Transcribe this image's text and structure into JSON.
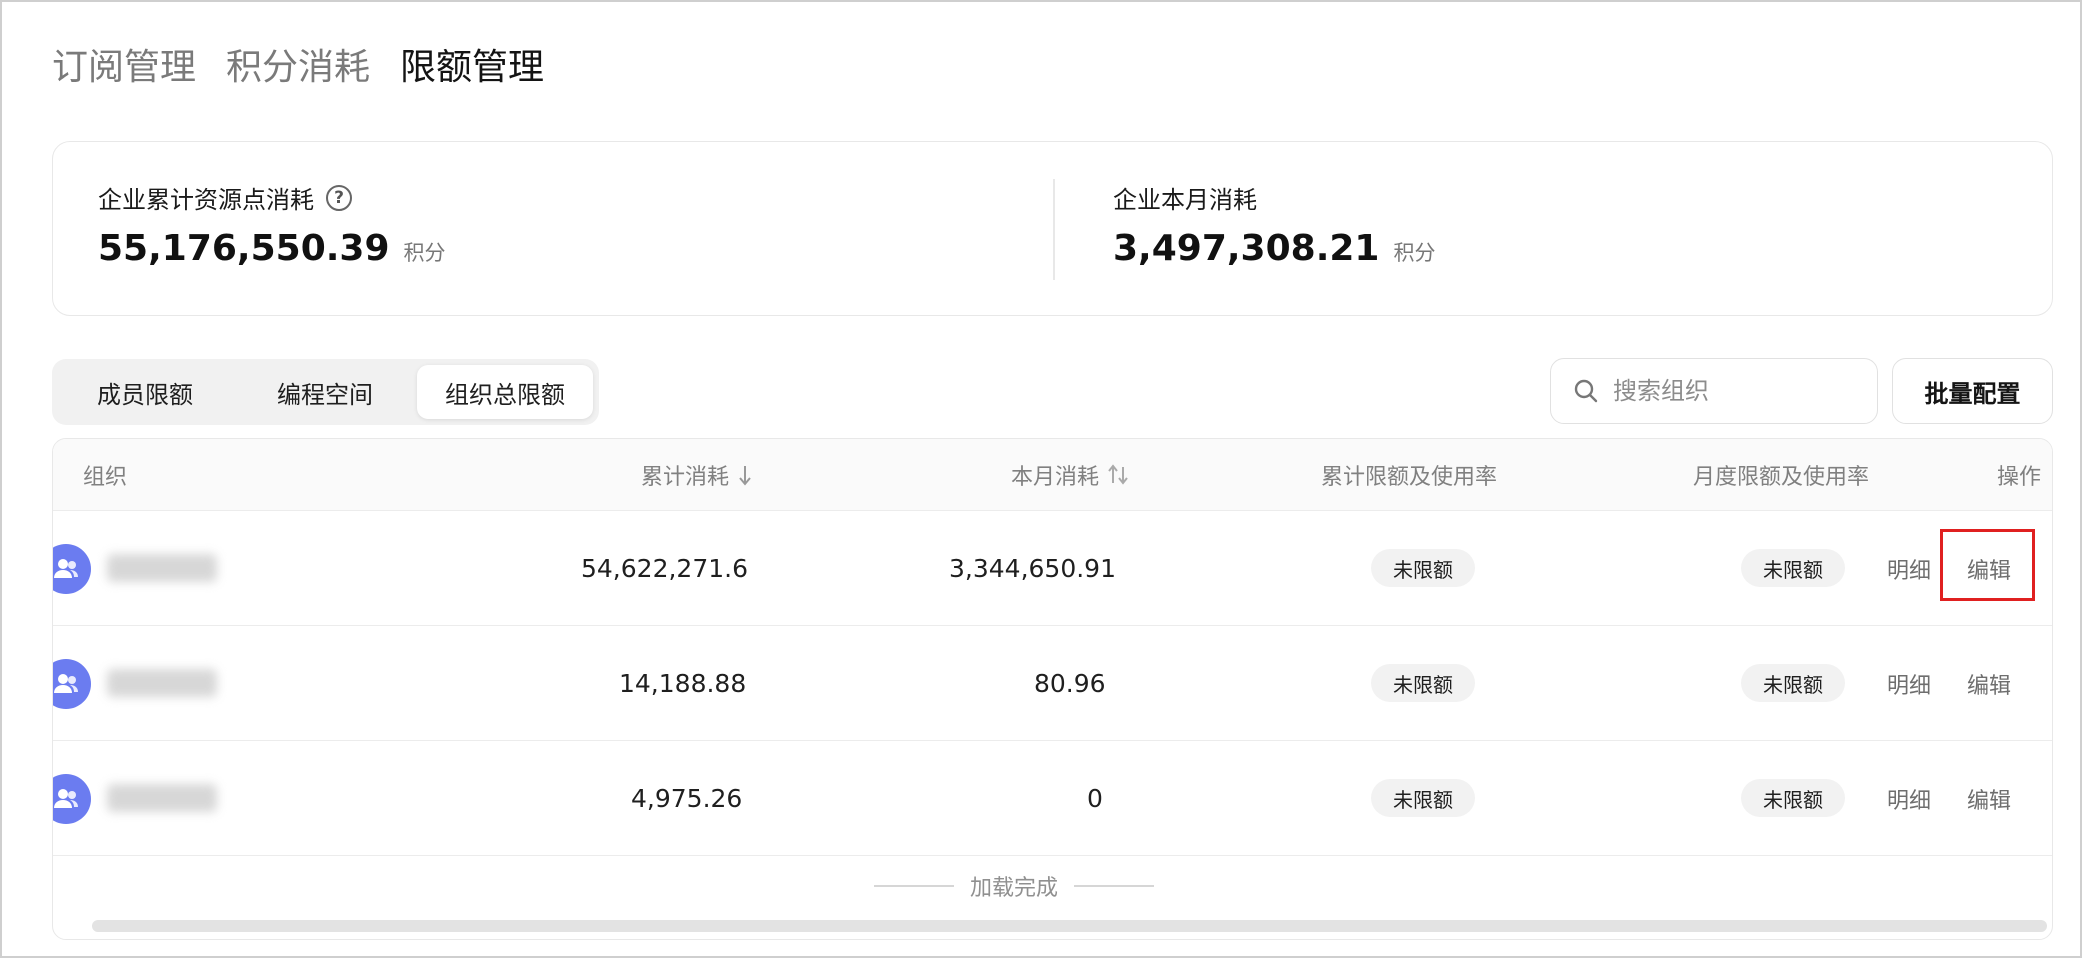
{
  "top_tabs": [
    "订阅管理",
    "积分消耗",
    "限额管理"
  ],
  "summary": {
    "total_label": "企业累计资源点消耗",
    "total_value": "55,176,550.39",
    "month_label": "企业本月消耗",
    "month_value": "3,497,308.21",
    "unit": "积分"
  },
  "segments": [
    "成员限额",
    "编程空间",
    "组织总限额"
  ],
  "active_segment": "组织总限额",
  "search": {
    "placeholder": "搜索组织"
  },
  "batch_button": "批量配置",
  "columns": [
    "组织",
    "累计消耗",
    "本月消耗",
    "累计限额及使用率",
    "月度限额及使用率",
    "操作"
  ],
  "rows": [
    {
      "total": "54,622,271.6",
      "month": "3,344,650.91",
      "total_limit": "未限额",
      "month_limit": "未限额"
    },
    {
      "total": "14,188.88",
      "month": "80.96",
      "total_limit": "未限额",
      "month_limit": "未限额"
    },
    {
      "total": "4,975.26",
      "month": "0",
      "total_limit": "未限额",
      "month_limit": "未限额"
    }
  ],
  "actions": {
    "detail": "明细",
    "edit": "编辑"
  },
  "load_done": "加载完成",
  "colors": {
    "avatar": "#6b7cf0",
    "highlight": "#e02020"
  }
}
